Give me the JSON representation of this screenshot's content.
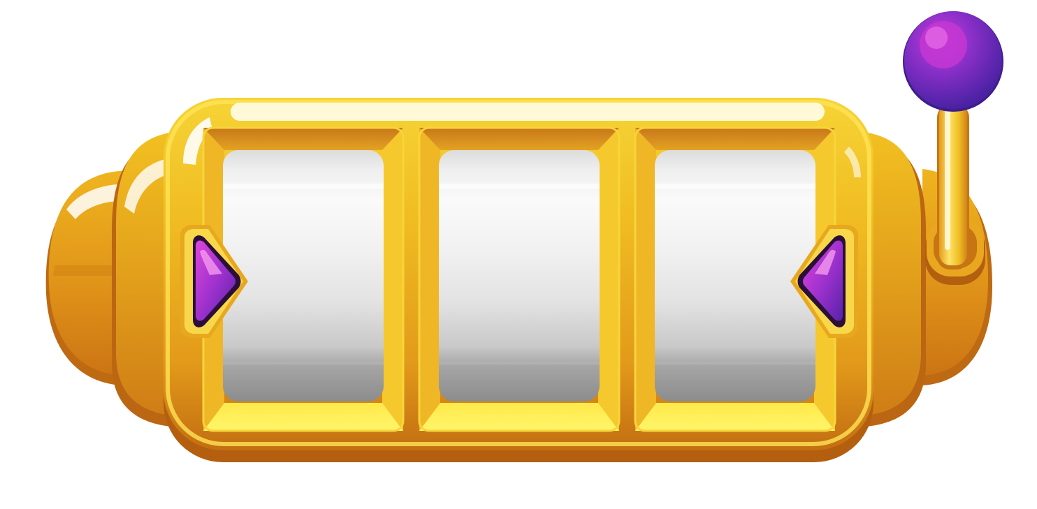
{
  "machine": {
    "reel_count": 3,
    "reels": [
      {
        "symbol": ""
      },
      {
        "symbol": ""
      },
      {
        "symbol": ""
      }
    ]
  },
  "colors": {
    "gold_light": "#fff35a",
    "gold_mid": "#f2c21e",
    "gold_dark": "#d88a14",
    "gold_shadow": "#b8650f",
    "reel_top": "#f5f5f5",
    "reel_bottom": "#8e8e8e",
    "purple_light": "#d43ad6",
    "purple_dark": "#5b25b0",
    "lever_ball": "#7a2fc4"
  },
  "icons": {
    "left_marker": "triangle-right-icon",
    "right_marker": "triangle-left-icon",
    "lever": "lever-icon"
  }
}
